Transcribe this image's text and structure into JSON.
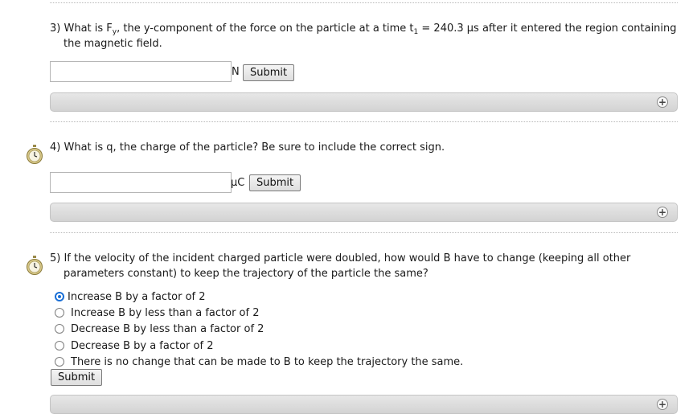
{
  "q3": {
    "number": "3)",
    "text_a": "What is F",
    "text_sub": "y",
    "text_b": ", the y-component of the force on the particle at a time t",
    "text_sub2": "1",
    "text_c": " = 240.3 μs after it entered the region containing",
    "text_line2": "the magnetic field.",
    "input_value": "",
    "unit": "N",
    "submit_label": "Submit"
  },
  "q4": {
    "text": "4) What is q, the charge of the particle? Be sure to include the correct sign.",
    "input_value": "",
    "unit": "μC",
    "submit_label": "Submit"
  },
  "q5": {
    "text_line1": "5) If the velocity of the incident charged particle were doubled, how would B have to change (keeping all other",
    "text_line2": "parameters constant) to keep the trajectory of the particle the same?",
    "options": [
      "Increase B by a factor of 2",
      "Increase B by less than a factor of 2",
      "Decrease B by less than a factor of 2",
      "Decrease B by a factor of 2",
      "There is no change that can be made to B to keep the trajectory the same."
    ],
    "selected_index": 0,
    "submit_label": "Submit"
  },
  "icons": {
    "expand": "plus-circle-icon",
    "timer": "stopwatch-icon"
  },
  "colors": {
    "radio_selected": "#1a6fd6",
    "bar": "#dcdcdc"
  }
}
